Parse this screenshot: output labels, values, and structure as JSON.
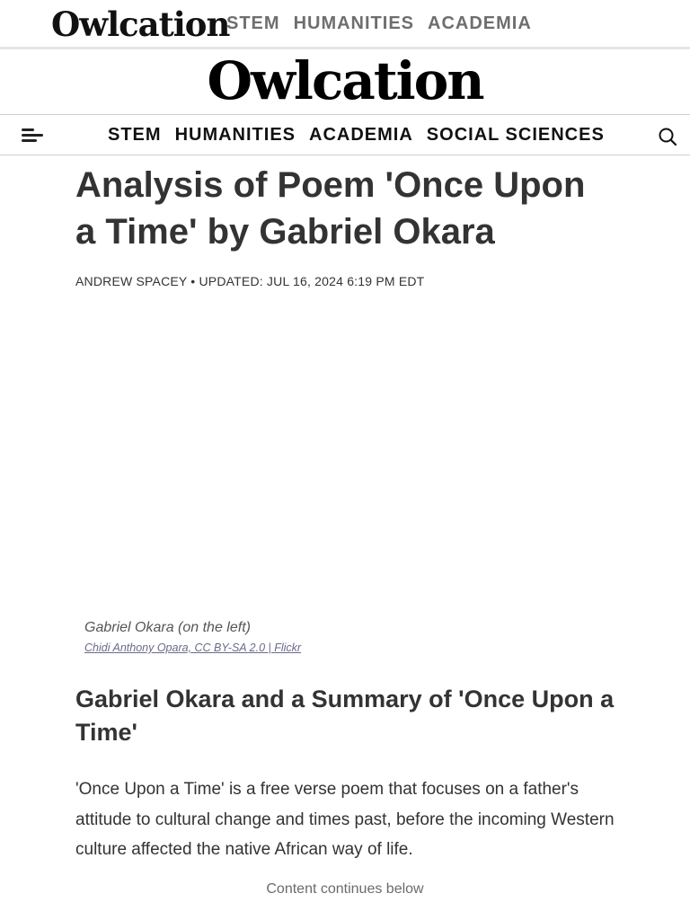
{
  "header": {
    "logo_small": "Owlcation",
    "mini_nav": [
      "STEM",
      "HUMANITIES",
      "ACADEMIA"
    ],
    "logo_big": "Owlcation"
  },
  "main_nav": {
    "menu_icon": "hamburger-menu-icon",
    "links": [
      "STEM",
      "HUMANITIES",
      "ACADEMIA",
      "SOCIAL SCIENCES"
    ],
    "search_icon": "search-icon"
  },
  "article": {
    "title": "Analysis of Poem 'Once Upon a Time' by Gabriel Okara",
    "author": "ANDREW SPACEY",
    "separator": " • ",
    "updated": "UPDATED: JUL 16, 2024 6:19 PM EDT",
    "image_caption": "Gabriel Okara (on the left)",
    "image_credit": "Chidi Anthony Opara, CC BY-SA 2.0 | Flickr",
    "section_heading": "Gabriel Okara and a Summary of 'Once Upon a Time'",
    "paragraph": "'Once Upon a Time' is a free verse poem that focuses on a father's attitude to cultural change and times past, before the incoming Western culture affected the native African way of life.",
    "continues_label": "Content continues below"
  },
  "colors": {
    "text": "#333333",
    "nav_muted": "#6e6e6e",
    "credit_link": "#6a6a8a",
    "divider": "#cfcfcf"
  }
}
